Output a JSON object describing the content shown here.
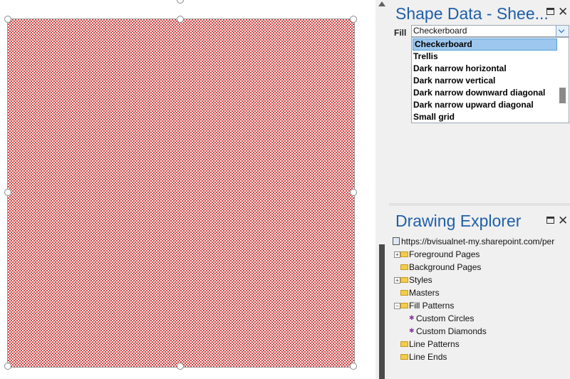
{
  "shape_data": {
    "title": "Shape Data - Shee...",
    "fill_label": "Fill",
    "fill_value": "Checkerboard",
    "options": [
      "Checkerboard",
      "Trellis",
      "Dark narrow horizontal",
      "Dark narrow vertical",
      "Dark narrow downward diagonal",
      "Dark narrow upward diagonal",
      "Small grid"
    ],
    "selected_option": "Checkerboard"
  },
  "drawing_explorer": {
    "title": "Drawing Explorer",
    "root": "https://bvisualnet-my.sharepoint.com/per",
    "items": [
      {
        "label": "Foreground Pages",
        "expandable": true
      },
      {
        "label": "Background Pages",
        "expandable": false
      },
      {
        "label": "Styles",
        "expandable": true
      },
      {
        "label": "Masters",
        "expandable": false
      },
      {
        "label": "Fill Patterns",
        "expanded": true
      },
      {
        "label": "Custom Circles",
        "child": true
      },
      {
        "label": "Custom Diamonds",
        "child": true
      },
      {
        "label": "Line Patterns",
        "expandable": false
      },
      {
        "label": "Line Ends",
        "expandable": false
      }
    ]
  },
  "icons": {
    "window": "window-icon",
    "close": "close-icon",
    "chevron": "chevron-down-icon",
    "expand": "plus-box-icon",
    "collapse": "minus-box-icon",
    "folder": "folder-icon",
    "pattern": "fill-pattern-icon"
  },
  "colors": {
    "accent": "#1f5fa8",
    "pattern_red": "#d24a4a",
    "selection": "#9dc7ee"
  },
  "glyphs": {
    "close": "✕",
    "plus": "+",
    "minus": "−",
    "pattern": "✱"
  }
}
